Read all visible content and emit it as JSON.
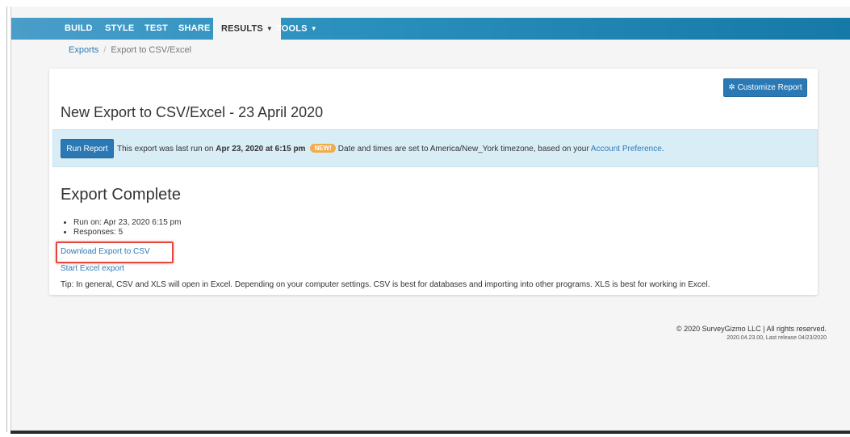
{
  "nav": {
    "items": [
      "BUILD",
      "STYLE",
      "TEST",
      "SHARE"
    ],
    "results": "RESULTS",
    "tools": "TOOLS"
  },
  "breadcrumb": {
    "root": "Exports",
    "current": "Export to CSV/Excel"
  },
  "report": {
    "customize_label": "Customize Report",
    "title": "New Export to CSV/Excel - 23 April 2020"
  },
  "alert": {
    "run_button": "Run Report",
    "prefix": "This export was last run on ",
    "run_date": "Apr 23, 2020 at 6:15 pm",
    "new_badge": "NEW!",
    "timezone_text": "Date and times are set to America/New_York timezone, based on your ",
    "preference_link": "Account Preference",
    "suffix": "."
  },
  "export": {
    "heading": "Export Complete",
    "run_on": "Run on: Apr 23, 2020 6:15 pm",
    "responses": "Responses: 5",
    "download_link": "Download Export to CSV",
    "excel_link": "Start Excel export",
    "tip": "Tip: In general, CSV and XLS will open in Excel. Depending on your computer settings. CSV is best for databases and importing into other programs. XLS is best for working in Excel."
  },
  "footer": {
    "copyright": "© 2020 SurveyGizmo LLC | All rights reserved.",
    "release": "2020.04.23.00, Last release 04/23/2020"
  },
  "colors": {
    "accent": "#2b79b4",
    "highlight_border": "#e0483e",
    "alert_bg": "#d9edf7",
    "badge": "#f0ad4e"
  }
}
